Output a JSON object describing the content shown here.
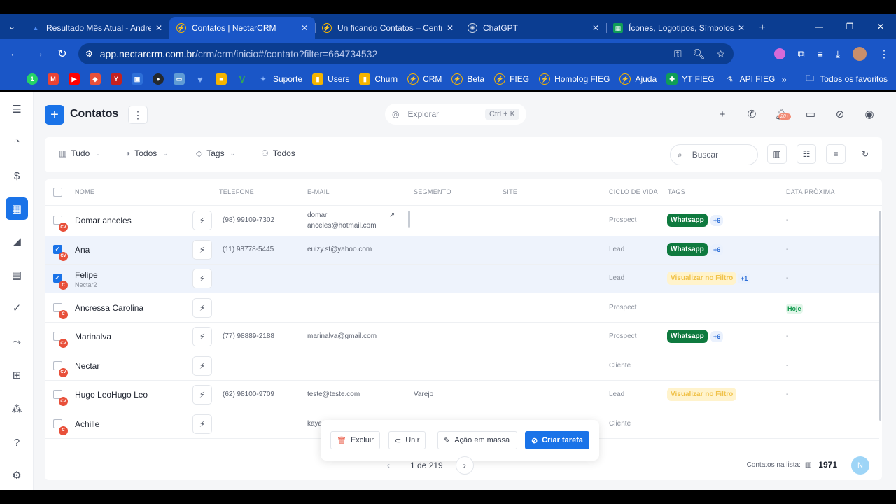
{
  "browser": {
    "tabs": [
      {
        "label": "Resultado Mês Atual - Andre",
        "icon_color": "#4c8bf5",
        "active": false
      },
      {
        "label": "Contatos | NectarCRM",
        "icon_color": "#f4b400",
        "active": true
      },
      {
        "label": "Un ficando Contatos – Centr",
        "icon_color": "#f4b400",
        "active": false
      },
      {
        "label": "ChatGPT",
        "icon_color": "#74aa9c",
        "active": false
      },
      {
        "label": "Ícones, Logotipos, Símbolos",
        "icon_color": "#0f9d58",
        "active": false
      }
    ],
    "url_host": "app.nectarcrm.com.br",
    "url_path": "/crm/crm/inicio#/contato?filter=664734532",
    "bookmarks": [
      {
        "label": "Suporte",
        "color": "#1a73e8"
      },
      {
        "label": "Users",
        "color": "#f4b400"
      },
      {
        "label": "Churn",
        "color": "#f4b400"
      },
      {
        "label": "CRM",
        "color": "#f4b400"
      },
      {
        "label": "Beta",
        "color": "#f4b400"
      },
      {
        "label": "FIEG",
        "color": "#f4b400"
      },
      {
        "label": "Homolog FIEG",
        "color": "#f4b400"
      },
      {
        "label": "Ajuda",
        "color": "#f4b400"
      },
      {
        "label": "YT FIEG",
        "color": "#0f9d58"
      },
      {
        "label": "API FIEG",
        "color": "#5f6368"
      }
    ],
    "all_bookmarks_label": "Todos os favoritos"
  },
  "header": {
    "title": "Contatos",
    "explorar_placeholder": "Explorar",
    "explorar_shortcut": "Ctrl + K",
    "notif_badge": "20+"
  },
  "filters": {
    "tudo": "Tudo",
    "todos_1": "Todos",
    "tags": "Tags",
    "todos_2": "Todos",
    "search_placeholder": "Buscar"
  },
  "table": {
    "columns": [
      "NOME",
      "TELEFONE",
      "E-MAIL",
      "SEGMENTO",
      "SITE",
      "CICLO DE VIDA",
      "TAGS",
      "DATA PRÓXIMA"
    ],
    "rows": [
      {
        "tipo": "CV",
        "name": "Domar anceles",
        "sub": "",
        "checked": false,
        "phone": "(98) 99109-7302",
        "email1": "domar",
        "email2": "anceles@hotmail.com",
        "segmento": "",
        "ciclo": "Prospect",
        "tag": "Whatsapp",
        "tag_style": "green",
        "more": "+6",
        "data": "-"
      },
      {
        "tipo": "CV",
        "name": "Ana",
        "sub": "",
        "checked": true,
        "phone": "(11) 98778-5445",
        "email1": "euizy.st@yahoo.com",
        "email2": "",
        "segmento": "",
        "ciclo": "Lead",
        "tag": "Whatsapp",
        "tag_style": "green",
        "more": "+6",
        "data": "-"
      },
      {
        "tipo": "C",
        "name": "Felipe",
        "sub": "Nectar2",
        "checked": true,
        "phone": "",
        "email1": "",
        "email2": "",
        "segmento": "",
        "ciclo": "Lead",
        "tag": "Visualizar no Filtro",
        "tag_style": "yellow",
        "more": "+1",
        "data": "-"
      },
      {
        "tipo": "C",
        "name": "Ancressa Carolina",
        "sub": "",
        "checked": false,
        "phone": "",
        "email1": "",
        "email2": "",
        "segmento": "",
        "ciclo": "Prospect",
        "tag": "",
        "tag_style": "",
        "more": "",
        "data": "Hoje"
      },
      {
        "tipo": "CV",
        "name": "Marinalva",
        "sub": "",
        "checked": false,
        "phone": "(77) 98889-2188",
        "email1": "marinalva@gmail.com",
        "email2": "",
        "segmento": "",
        "ciclo": "Prospect",
        "tag": "Whatsapp",
        "tag_style": "green",
        "more": "+6",
        "data": "-"
      },
      {
        "tipo": "CV",
        "name": "Nectar",
        "sub": "",
        "checked": false,
        "phone": "",
        "email1": "",
        "email2": "",
        "segmento": "",
        "ciclo": "Cliente",
        "tag": "",
        "tag_style": "",
        "more": "",
        "data": "-"
      },
      {
        "tipo": "CV",
        "name": "Hugo LeoHugo Leo",
        "sub": "",
        "checked": false,
        "phone": "(62) 98100-9709",
        "email1": "teste@teste.com",
        "email2": "",
        "segmento": "Varejo",
        "ciclo": "Lead",
        "tag": "Visualizar no Filtro",
        "tag_style": "yellow",
        "more": "",
        "data": "-"
      },
      {
        "tipo": "C",
        "name": "Achille",
        "sub": "",
        "checked": false,
        "phone": "",
        "email1": "kaya...",
        "email2": "",
        "segmento": "",
        "ciclo": "Cliente",
        "tag": "",
        "tag_style": "",
        "more": "",
        "data": ""
      }
    ]
  },
  "bulk_actions": {
    "excluir": "Excluir",
    "unir": "Unir",
    "acao_em_massa": "Ação em massa",
    "criar_tarefa": "Criar tarefa"
  },
  "pagination": {
    "label": "1 de 219"
  },
  "footer": {
    "count_label": "Contatos na lista:",
    "count_value": "1971",
    "user_initial": "N"
  }
}
